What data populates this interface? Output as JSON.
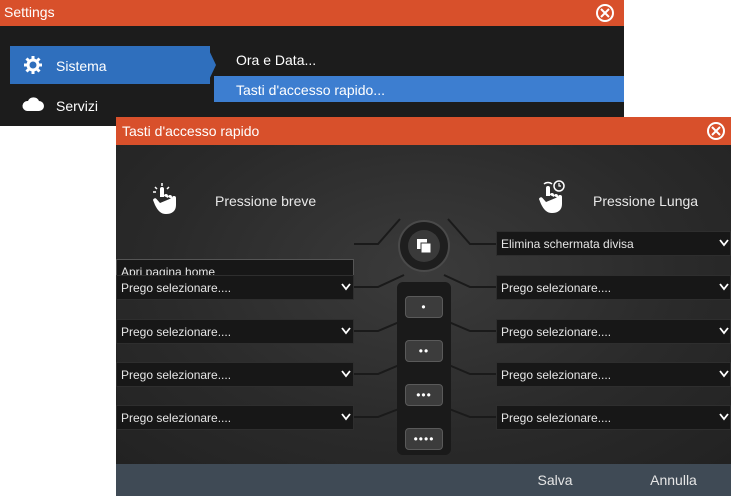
{
  "settings": {
    "title": "Settings",
    "sidebar": [
      {
        "label": "Sistema",
        "icon": "gear-icon",
        "selected": true
      },
      {
        "label": "Servizi",
        "icon": "cloud-icon",
        "selected": false
      }
    ],
    "submenu": [
      {
        "label": "Ora e Data...",
        "selected": false
      },
      {
        "label": "Tasti d'accesso rapido...",
        "selected": true
      }
    ]
  },
  "dialog": {
    "title": "Tasti d'accesso rapido",
    "short_press_label": "Pressione breve",
    "long_press_label": "Pressione Lunga",
    "home_action": "Apri pagina home",
    "short_press_slots": [
      "Prego selezionare....",
      "Prego selezionare....",
      "Prego selezionare....",
      "Prego selezionare...."
    ],
    "long_press_slots": [
      "Elimina schermata divisa",
      "Prego selezionare....",
      "Prego selezionare....",
      "Prego selezionare....",
      "Prego selezionare...."
    ],
    "key_buttons": [
      "•",
      "••",
      "•••",
      "••••"
    ],
    "save_label": "Salva",
    "cancel_label": "Annulla"
  },
  "colors": {
    "titlebar": "#d8502b",
    "selected": "#2f6fbd",
    "footer": "#3f4a55"
  }
}
